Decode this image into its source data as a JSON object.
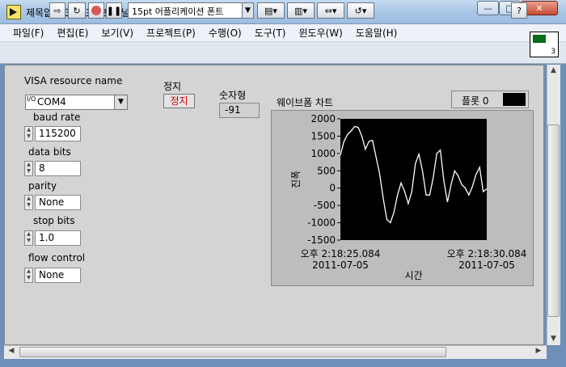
{
  "window": {
    "title": "제목없음 3.vi 프런트패널 *"
  },
  "menu": {
    "items": [
      "파일(F)",
      "편집(E)",
      "보기(V)",
      "프로젝트(P)",
      "수행(O)",
      "도구(T)",
      "윈도우(W)",
      "도움말(H)"
    ]
  },
  "toolbar": {
    "font_label": "15pt 어플리케이션 폰트",
    "vi_icon_number": "3"
  },
  "controls": {
    "visa": {
      "label": "VISA resource name",
      "value": "COM4"
    },
    "baud": {
      "label": "baud rate",
      "value": "115200"
    },
    "databits": {
      "label": "data bits",
      "value": "8"
    },
    "parity": {
      "label": "parity",
      "value": "None"
    },
    "stopbits": {
      "label": "stop bits",
      "value": "1.0"
    },
    "flow": {
      "label": "flow control",
      "value": "None"
    },
    "stop": {
      "label": "정지",
      "button_text": "정지"
    },
    "numeric": {
      "label": "숫자형",
      "value": "-91"
    }
  },
  "chart_data": {
    "type": "line",
    "title": "웨이브폼 차트",
    "xlabel": "시간",
    "ylabel": "진폭",
    "legend_label": "플롯 0",
    "ylim": [
      -1500,
      2000
    ],
    "yticks": [
      2000,
      1500,
      1000,
      500,
      0,
      -500,
      -1000,
      -1500
    ],
    "x_start": {
      "time": "오후 2:18:25.084",
      "date": "2011-07-05"
    },
    "x_end": {
      "time": "오후 2:18:30.084",
      "date": "2011-07-05"
    },
    "series": [
      {
        "values": [
          950,
          1350,
          1550,
          1650,
          1780,
          1750,
          1500,
          1120,
          1350,
          1380,
          900,
          400,
          -300,
          -900,
          -1000,
          -700,
          -200,
          150,
          -100,
          -450,
          -100,
          700,
          980,
          500,
          -200,
          -200,
          300,
          1000,
          1100,
          200,
          -400,
          100,
          500,
          350,
          100,
          0,
          -200,
          50,
          400,
          600,
          -100,
          -20
        ]
      }
    ],
    "line_color": "#ffffff",
    "plot_background": "#000000"
  }
}
